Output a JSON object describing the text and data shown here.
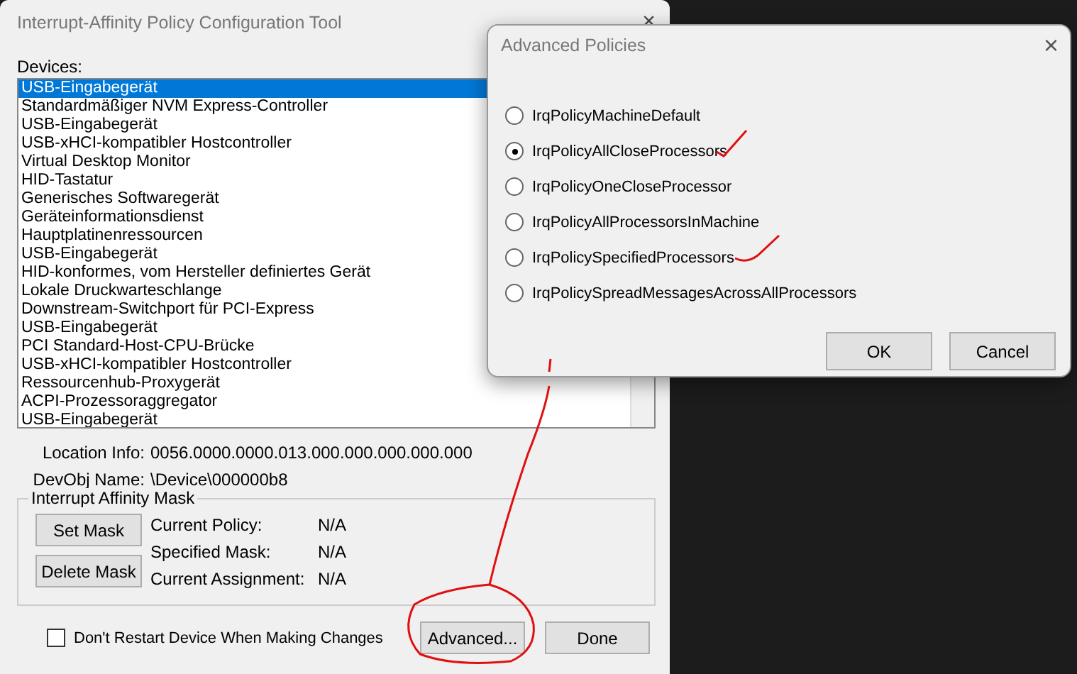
{
  "main_window": {
    "title": "Interrupt-Affinity Policy Configuration Tool",
    "close": "×",
    "devices_label": "Devices:",
    "devices": [
      {
        "label": "USB-Eingabegerät",
        "selected": true
      },
      {
        "label": "Standardmäßiger NVM Express-Controller",
        "selected": false
      },
      {
        "label": "USB-Eingabegerät",
        "selected": false
      },
      {
        "label": "USB-xHCI-kompatibler Hostcontroller",
        "selected": false
      },
      {
        "label": "Virtual Desktop Monitor",
        "selected": false
      },
      {
        "label": "HID-Tastatur",
        "selected": false
      },
      {
        "label": "Generisches Softwaregerät",
        "selected": false
      },
      {
        "label": "Geräteinformationsdienst",
        "selected": false
      },
      {
        "label": "Hauptplatinenressourcen",
        "selected": false
      },
      {
        "label": "USB-Eingabegerät",
        "selected": false
      },
      {
        "label": "HID-konformes, vom Hersteller definiertes Gerät",
        "selected": false
      },
      {
        "label": "Lokale Druckwarteschlange",
        "selected": false
      },
      {
        "label": "Downstream-Switchport für PCI-Express",
        "selected": false
      },
      {
        "label": "USB-Eingabegerät",
        "selected": false
      },
      {
        "label": "PCI Standard-Host-CPU-Brücke",
        "selected": false
      },
      {
        "label": "USB-xHCI-kompatibler Hostcontroller",
        "selected": false
      },
      {
        "label": "Ressourcenhub-Proxygerät",
        "selected": false
      },
      {
        "label": "ACPI-Prozessoraggregator",
        "selected": false
      },
      {
        "label": "USB-Eingabegerät",
        "selected": false
      }
    ],
    "info": [
      {
        "label": "Location Info:",
        "value": "0056.0000.0000.013.000.000.000.000.000"
      },
      {
        "label": "DevObj Name:",
        "value": "\\Device\\000000b8"
      }
    ],
    "mask_group": {
      "title": "Interrupt Affinity Mask",
      "buttons": [
        "Set Mask",
        "Delete Mask"
      ],
      "fields": [
        {
          "label": "Current Policy:",
          "value": "N/A"
        },
        {
          "label": "Specified Mask:",
          "value": "N/A"
        },
        {
          "label": "Current Assignment:",
          "value": "N/A"
        }
      ]
    },
    "dont_restart": {
      "label": "Don't Restart Device When Making Changes",
      "checked": false
    },
    "buttons": [
      "Advanced...",
      "Done"
    ]
  },
  "dialog": {
    "title": "Advanced Policies",
    "close": "×",
    "policies": [
      {
        "label": "IrqPolicyMachineDefault",
        "selected": false
      },
      {
        "label": "IrqPolicyAllCloseProcessors",
        "selected": true
      },
      {
        "label": "IrqPolicyOneCloseProcessor",
        "selected": false
      },
      {
        "label": "IrqPolicyAllProcessorsInMachine",
        "selected": false
      },
      {
        "label": "IrqPolicySpecifiedProcessors",
        "selected": false
      },
      {
        "label": "IrqPolicySpreadMessagesAcrossAllProcessors",
        "selected": false
      }
    ],
    "buttons": [
      "OK",
      "Cancel"
    ]
  }
}
